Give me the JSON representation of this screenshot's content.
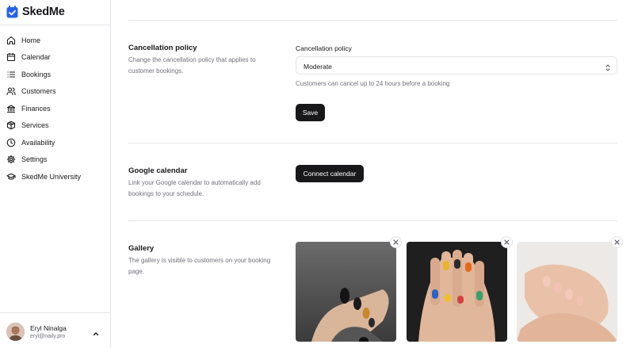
{
  "app": {
    "name": "SkedMe"
  },
  "sidebar": {
    "items": [
      {
        "label": "Home",
        "icon": "home-icon"
      },
      {
        "label": "Calendar",
        "icon": "calendar-icon"
      },
      {
        "label": "Bookings",
        "icon": "list-icon"
      },
      {
        "label": "Customers",
        "icon": "users-icon"
      },
      {
        "label": "Finances",
        "icon": "bank-icon"
      },
      {
        "label": "Services",
        "icon": "package-icon"
      },
      {
        "label": "Availability",
        "icon": "clock-icon"
      },
      {
        "label": "Settings",
        "icon": "gear-icon"
      },
      {
        "label": "SkedMe University",
        "icon": "graduation-cap-icon"
      }
    ]
  },
  "user": {
    "name": "Eryl Ninalga",
    "email": "eryl@naily.pro"
  },
  "cancellation": {
    "title": "Cancellation policy",
    "description": "Change the cancellation policy that applies to customer bookings.",
    "field_label": "Cancellation policy",
    "selected": "Moderate",
    "hint": "Customers can cancel up to 24 hours before a booking",
    "save_label": "Save"
  },
  "google_calendar": {
    "title": "Google calendar",
    "description": "Link your Google calendar to automatically add bookings to your schedule.",
    "connect_label": "Connect calendar"
  },
  "gallery": {
    "title": "Gallery",
    "description": "The gallery is visible to customers on your booking page.",
    "images": [
      {
        "name": "nail-photo-dark",
        "icon": "close-icon"
      },
      {
        "name": "nail-photo-colorful",
        "icon": "close-icon"
      },
      {
        "name": "nail-photo-nude",
        "icon": "close-icon"
      }
    ]
  },
  "colors": {
    "primary": "#18181b",
    "muted": "#71717a",
    "border": "#e5e7eb",
    "logo": "#2563eb"
  }
}
